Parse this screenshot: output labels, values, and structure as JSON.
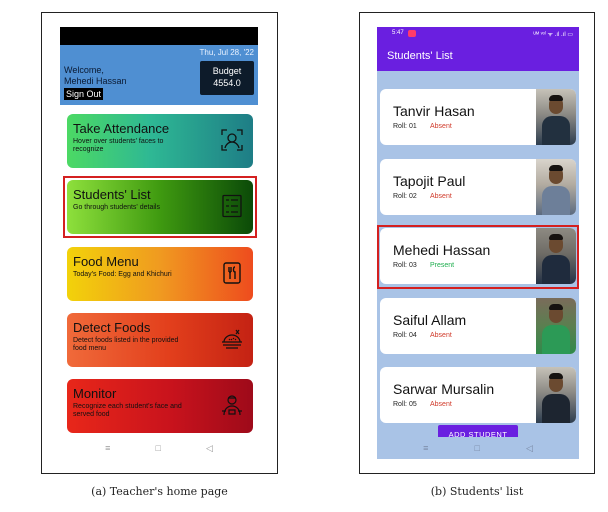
{
  "teacher_home": {
    "date": "Thu, Jul 28, '22",
    "welcome_line1": "Welcome,",
    "welcome_line2": "Mehedi Hassan",
    "sign_out": "Sign Out",
    "budget_label": "Budget",
    "budget_value": "4554.0",
    "cards": [
      {
        "title": "Take Attendance",
        "subtitle": "Hover over students' faces to recognize",
        "icon": "face-scan-icon"
      },
      {
        "title": "Students' List",
        "subtitle": "Go through students' details",
        "icon": "list-icon"
      },
      {
        "title": "Food Menu",
        "subtitle": "Today's Food: Egg and Khichuri",
        "icon": "menu-icon"
      },
      {
        "title": "Detect Foods",
        "subtitle": "Detect foods listed in the provided food menu",
        "icon": "food-tray-icon"
      },
      {
        "title": "Monitor",
        "subtitle": "Recognize each student's face and served food",
        "icon": "monitor-person-icon"
      }
    ],
    "nav": [
      "≡",
      "□",
      "◁"
    ]
  },
  "students_list": {
    "status_time": "5:47",
    "status_right": "ᵁᴹ ᵛᵒˡ ᯤ .ıl .ıl ▭",
    "title": "Students' List",
    "students": [
      {
        "name": "Tanvir Hasan",
        "roll": "Roll: 01",
        "status": "Absent"
      },
      {
        "name": "Tapojit Paul",
        "roll": "Roll: 02",
        "status": "Absent"
      },
      {
        "name": "Mehedi Hassan",
        "roll": "Roll: 03",
        "status": "Present"
      },
      {
        "name": "Saiful Allam",
        "roll": "Roll: 04",
        "status": "Absent"
      },
      {
        "name": "Sarwar Mursalin",
        "roll": "Roll: 05",
        "status": "Absent"
      }
    ],
    "add_button": "ADD STUDENT",
    "nav": [
      "≡",
      "□",
      "◁"
    ]
  },
  "captions": {
    "a": "(a) Teacher's home page",
    "b": "(b) Students' list"
  },
  "colors": {
    "header_blue": "#4f8fd2",
    "purple": "#6a1fe0",
    "absent": "#d03a2a",
    "present": "#1fae4f",
    "highlight": "#d42020"
  }
}
